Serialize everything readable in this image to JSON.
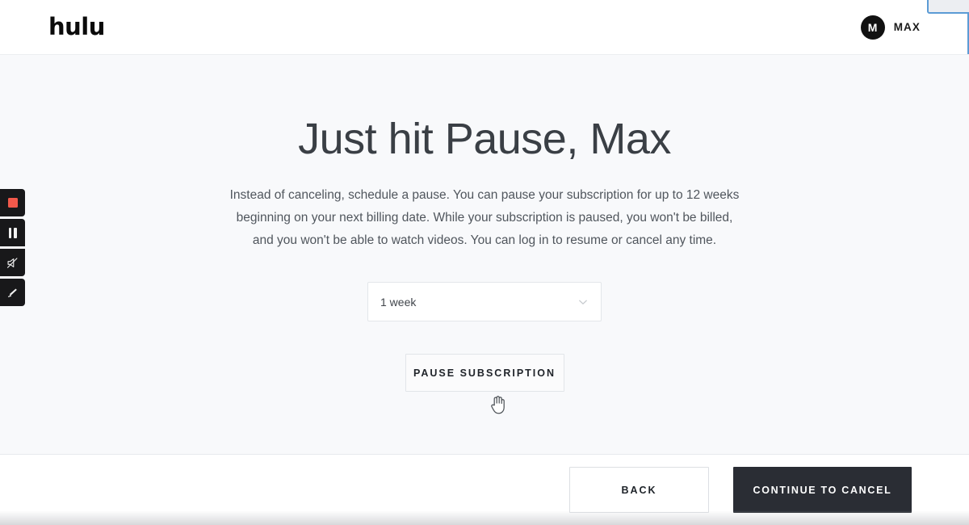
{
  "header": {
    "brand": "hulu",
    "avatar_initial": "M",
    "account_name": "MAX"
  },
  "main": {
    "title": "Just hit Pause, Max",
    "description": "Instead of canceling, schedule a pause. You can pause your subscription for up to 12 weeks beginning on your next billing date. While your subscription is paused, you won't be billed, and you won't be able to watch videos. You can log in to resume or cancel any time.",
    "duration_select": {
      "value": "1 week",
      "chevron_icon": "chevron-down-icon"
    },
    "pause_button_label": "PAUSE SUBSCRIPTION"
  },
  "footer": {
    "back_label": "BACK",
    "continue_label": "CONTINUE TO CANCEL"
  },
  "recorder_toolbar": {
    "buttons": [
      {
        "name": "stop-recording-button",
        "icon": "stop-square-icon"
      },
      {
        "name": "pause-recording-button",
        "icon": "pause-bars-icon"
      },
      {
        "name": "mute-audio-button",
        "icon": "speaker-muted-icon"
      },
      {
        "name": "draw-annotate-button",
        "icon": "pen-icon"
      }
    ]
  },
  "cursor": {
    "icon": "pointing-hand-cursor"
  },
  "colors": {
    "page_background": "#f8f9fb",
    "header_background": "#ffffff",
    "title_text": "#3a3f45",
    "body_text": "#50565d",
    "primary_button": "#2a2d34",
    "stop_record_red": "#f2594b",
    "recorder_toolbar": "#18181a",
    "overlay_accent": "#5b9bd5"
  }
}
